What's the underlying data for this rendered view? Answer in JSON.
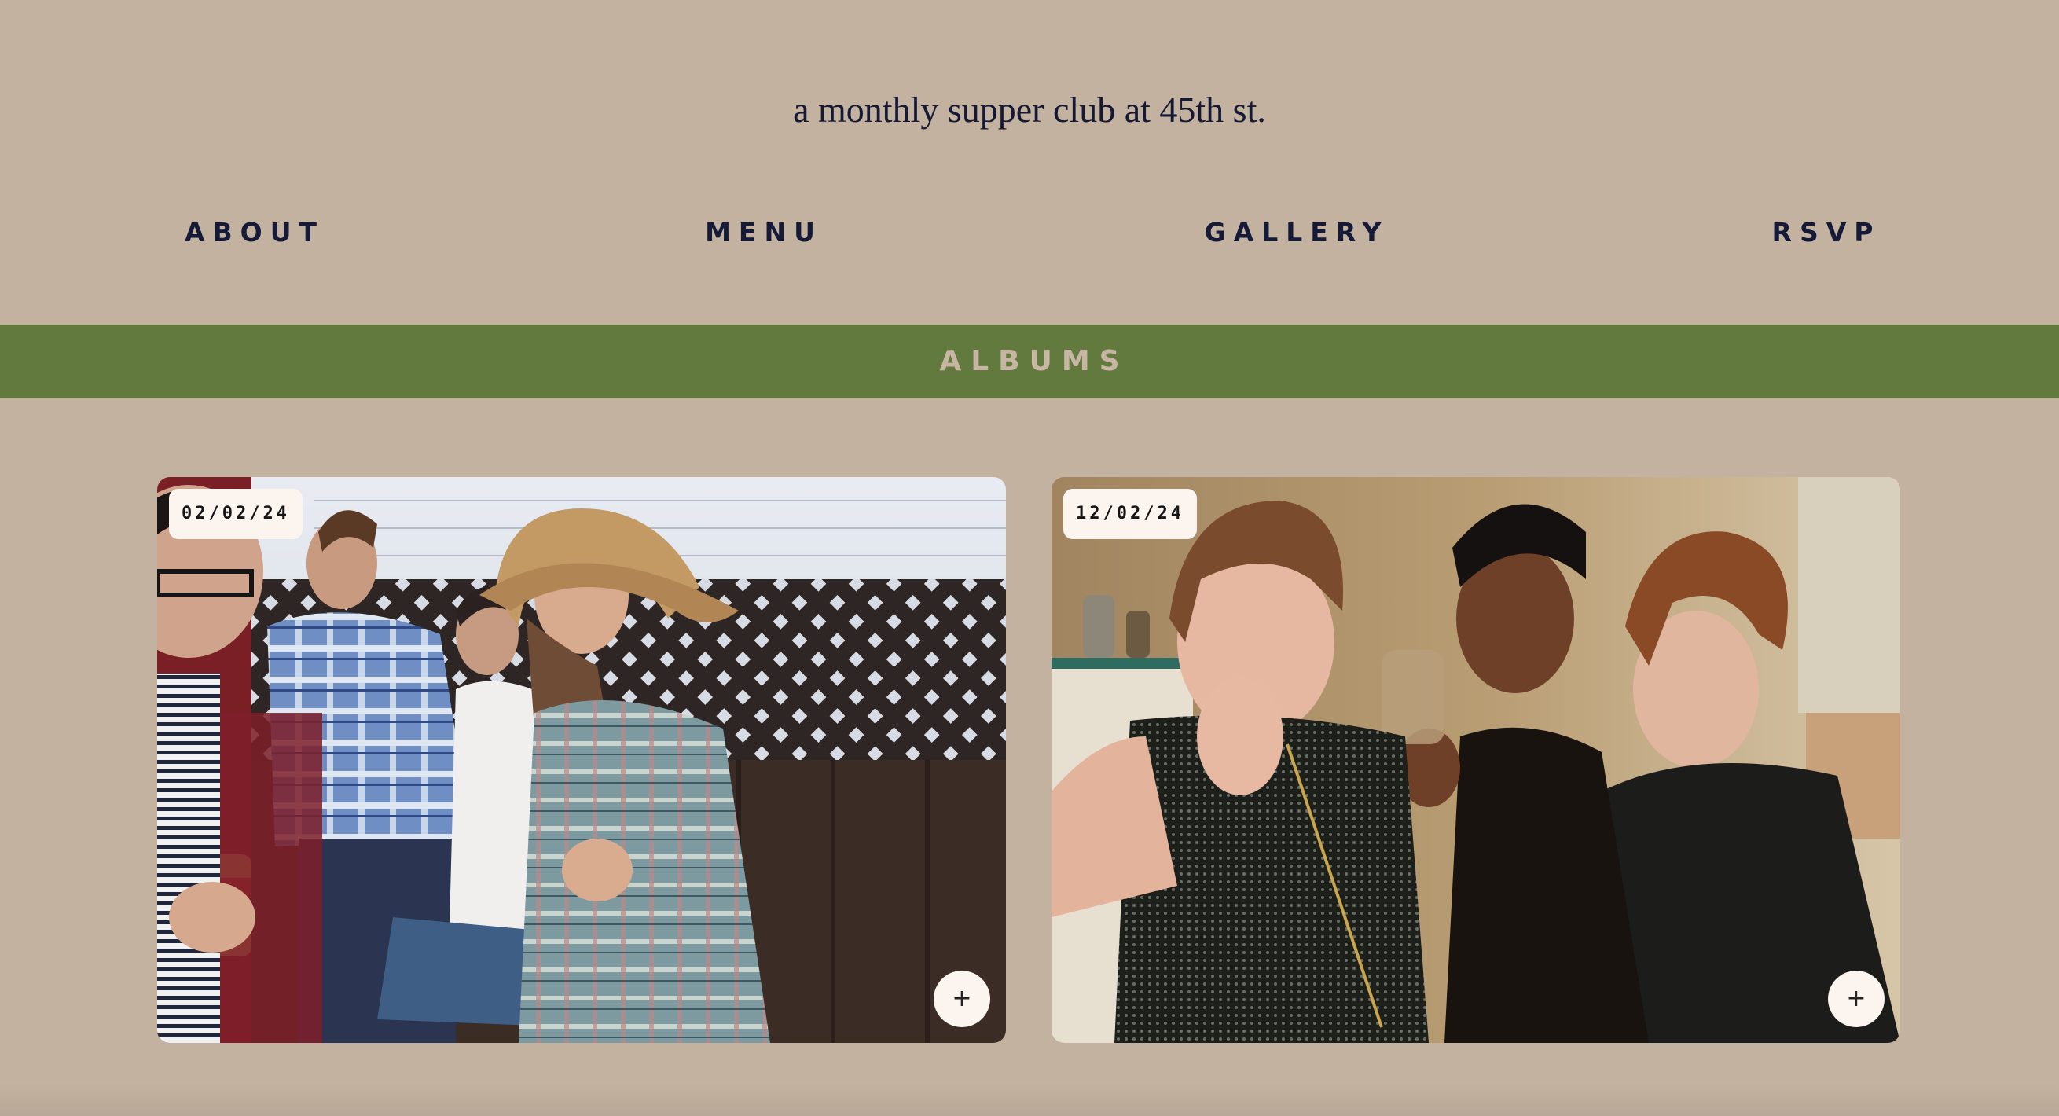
{
  "header": {
    "tagline": "a monthly supper club at 45th st."
  },
  "nav": {
    "items": [
      {
        "label": "ABOUT"
      },
      {
        "label": "MENU"
      },
      {
        "label": "GALLERY"
      },
      {
        "label": "RSVP"
      }
    ]
  },
  "section": {
    "title": "ALBUMS"
  },
  "albums": [
    {
      "date": "02/02/24",
      "button": "+",
      "icon": "plus-icon"
    },
    {
      "date": "12/02/24",
      "button": "+",
      "icon": "plus-icon"
    }
  ],
  "colors": {
    "background": "#c4b2a0",
    "banner": "#637a3f",
    "text": "#141a38",
    "pill": "#fbf4ef"
  }
}
